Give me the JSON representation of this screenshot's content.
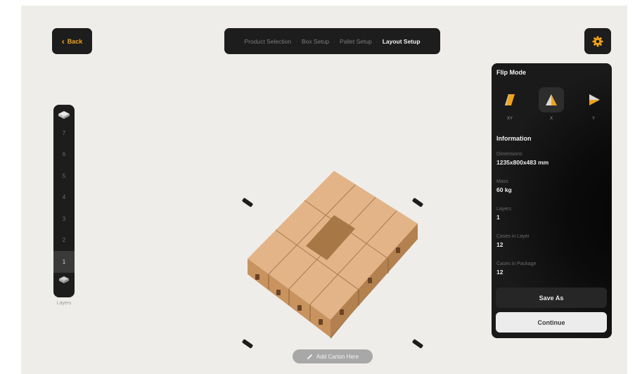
{
  "header": {
    "back_label": "Back",
    "steps": [
      {
        "label": "Product Selection",
        "active": false
      },
      {
        "label": "Box Setup",
        "active": false
      },
      {
        "label": "Pallet Setup",
        "active": false
      },
      {
        "label": "Layout Setup",
        "active": true
      }
    ]
  },
  "layers": {
    "items": [
      "7",
      "6",
      "5",
      "4",
      "3",
      "2",
      "1"
    ],
    "active": "1",
    "label": "Layers"
  },
  "canvas": {
    "add_carton_label": "Add Carton Here"
  },
  "panel": {
    "flip_title": "Flip Mode",
    "flip_options": [
      {
        "label": "XY",
        "icon": "flip-xy-icon",
        "selected": false
      },
      {
        "label": "X",
        "icon": "flip-x-icon",
        "selected": true
      },
      {
        "label": "Y",
        "icon": "flip-y-icon",
        "selected": false
      }
    ],
    "info_title": "Information",
    "info": [
      {
        "key": "Dimensions",
        "value": "1235x800x483 mm"
      },
      {
        "key": "Mass",
        "value": "60 kg"
      },
      {
        "key": "Layers",
        "value": "1"
      },
      {
        "key": "Cases in Layer",
        "value": "12"
      },
      {
        "key": "Cases in Package",
        "value": "12"
      }
    ],
    "save_as_label": "Save As",
    "continue_label": "Continue"
  },
  "colors": {
    "accent": "#f0a21a",
    "dark": "#1d1d1d",
    "background": "#efedea",
    "box": "#d7a67a"
  }
}
